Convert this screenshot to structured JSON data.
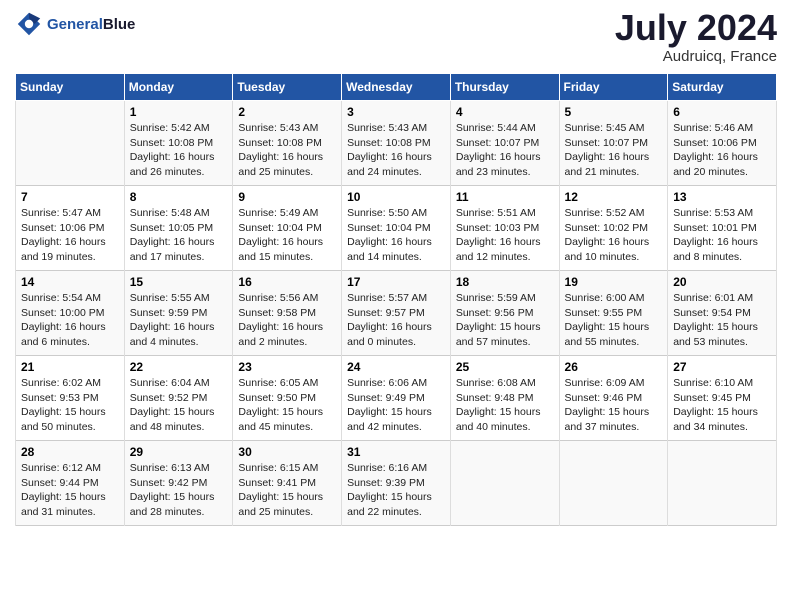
{
  "header": {
    "logo_line1": "General",
    "logo_line2": "Blue",
    "month_title": "July 2024",
    "location": "Audruicq, France"
  },
  "days_of_week": [
    "Sunday",
    "Monday",
    "Tuesday",
    "Wednesday",
    "Thursday",
    "Friday",
    "Saturday"
  ],
  "weeks": [
    [
      {
        "num": "",
        "info": ""
      },
      {
        "num": "1",
        "info": "Sunrise: 5:42 AM\nSunset: 10:08 PM\nDaylight: 16 hours\nand 26 minutes."
      },
      {
        "num": "2",
        "info": "Sunrise: 5:43 AM\nSunset: 10:08 PM\nDaylight: 16 hours\nand 25 minutes."
      },
      {
        "num": "3",
        "info": "Sunrise: 5:43 AM\nSunset: 10:08 PM\nDaylight: 16 hours\nand 24 minutes."
      },
      {
        "num": "4",
        "info": "Sunrise: 5:44 AM\nSunset: 10:07 PM\nDaylight: 16 hours\nand 23 minutes."
      },
      {
        "num": "5",
        "info": "Sunrise: 5:45 AM\nSunset: 10:07 PM\nDaylight: 16 hours\nand 21 minutes."
      },
      {
        "num": "6",
        "info": "Sunrise: 5:46 AM\nSunset: 10:06 PM\nDaylight: 16 hours\nand 20 minutes."
      }
    ],
    [
      {
        "num": "7",
        "info": "Sunrise: 5:47 AM\nSunset: 10:06 PM\nDaylight: 16 hours\nand 19 minutes."
      },
      {
        "num": "8",
        "info": "Sunrise: 5:48 AM\nSunset: 10:05 PM\nDaylight: 16 hours\nand 17 minutes."
      },
      {
        "num": "9",
        "info": "Sunrise: 5:49 AM\nSunset: 10:04 PM\nDaylight: 16 hours\nand 15 minutes."
      },
      {
        "num": "10",
        "info": "Sunrise: 5:50 AM\nSunset: 10:04 PM\nDaylight: 16 hours\nand 14 minutes."
      },
      {
        "num": "11",
        "info": "Sunrise: 5:51 AM\nSunset: 10:03 PM\nDaylight: 16 hours\nand 12 minutes."
      },
      {
        "num": "12",
        "info": "Sunrise: 5:52 AM\nSunset: 10:02 PM\nDaylight: 16 hours\nand 10 minutes."
      },
      {
        "num": "13",
        "info": "Sunrise: 5:53 AM\nSunset: 10:01 PM\nDaylight: 16 hours\nand 8 minutes."
      }
    ],
    [
      {
        "num": "14",
        "info": "Sunrise: 5:54 AM\nSunset: 10:00 PM\nDaylight: 16 hours\nand 6 minutes."
      },
      {
        "num": "15",
        "info": "Sunrise: 5:55 AM\nSunset: 9:59 PM\nDaylight: 16 hours\nand 4 minutes."
      },
      {
        "num": "16",
        "info": "Sunrise: 5:56 AM\nSunset: 9:58 PM\nDaylight: 16 hours\nand 2 minutes."
      },
      {
        "num": "17",
        "info": "Sunrise: 5:57 AM\nSunset: 9:57 PM\nDaylight: 16 hours\nand 0 minutes."
      },
      {
        "num": "18",
        "info": "Sunrise: 5:59 AM\nSunset: 9:56 PM\nDaylight: 15 hours\nand 57 minutes."
      },
      {
        "num": "19",
        "info": "Sunrise: 6:00 AM\nSunset: 9:55 PM\nDaylight: 15 hours\nand 55 minutes."
      },
      {
        "num": "20",
        "info": "Sunrise: 6:01 AM\nSunset: 9:54 PM\nDaylight: 15 hours\nand 53 minutes."
      }
    ],
    [
      {
        "num": "21",
        "info": "Sunrise: 6:02 AM\nSunset: 9:53 PM\nDaylight: 15 hours\nand 50 minutes."
      },
      {
        "num": "22",
        "info": "Sunrise: 6:04 AM\nSunset: 9:52 PM\nDaylight: 15 hours\nand 48 minutes."
      },
      {
        "num": "23",
        "info": "Sunrise: 6:05 AM\nSunset: 9:50 PM\nDaylight: 15 hours\nand 45 minutes."
      },
      {
        "num": "24",
        "info": "Sunrise: 6:06 AM\nSunset: 9:49 PM\nDaylight: 15 hours\nand 42 minutes."
      },
      {
        "num": "25",
        "info": "Sunrise: 6:08 AM\nSunset: 9:48 PM\nDaylight: 15 hours\nand 40 minutes."
      },
      {
        "num": "26",
        "info": "Sunrise: 6:09 AM\nSunset: 9:46 PM\nDaylight: 15 hours\nand 37 minutes."
      },
      {
        "num": "27",
        "info": "Sunrise: 6:10 AM\nSunset: 9:45 PM\nDaylight: 15 hours\nand 34 minutes."
      }
    ],
    [
      {
        "num": "28",
        "info": "Sunrise: 6:12 AM\nSunset: 9:44 PM\nDaylight: 15 hours\nand 31 minutes."
      },
      {
        "num": "29",
        "info": "Sunrise: 6:13 AM\nSunset: 9:42 PM\nDaylight: 15 hours\nand 28 minutes."
      },
      {
        "num": "30",
        "info": "Sunrise: 6:15 AM\nSunset: 9:41 PM\nDaylight: 15 hours\nand 25 minutes."
      },
      {
        "num": "31",
        "info": "Sunrise: 6:16 AM\nSunset: 9:39 PM\nDaylight: 15 hours\nand 22 minutes."
      },
      {
        "num": "",
        "info": ""
      },
      {
        "num": "",
        "info": ""
      },
      {
        "num": "",
        "info": ""
      }
    ]
  ]
}
